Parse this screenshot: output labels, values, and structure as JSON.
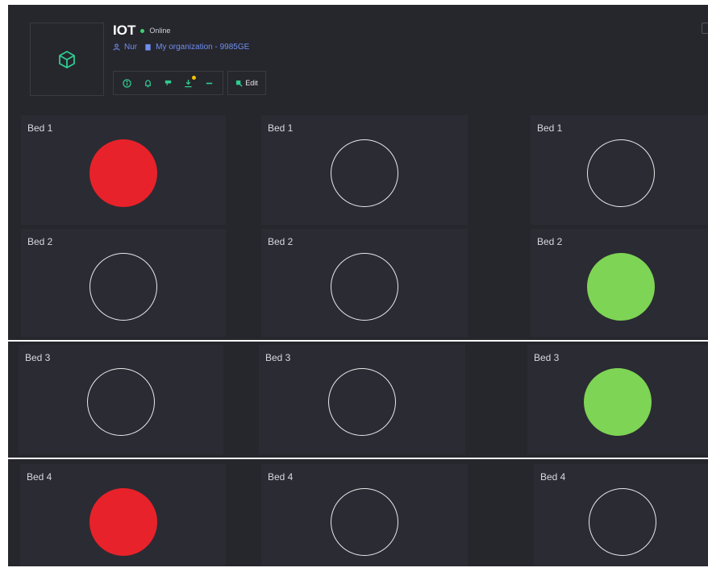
{
  "device": {
    "name": "IOT",
    "status": "Online",
    "user": "Nur",
    "organization": "My organization - 9985GE",
    "edit_label": "Edit",
    "colors": {
      "accent": "#2ecc8f",
      "status": "#3fd16f",
      "link": "#6f8ff0"
    }
  },
  "toolbar": {
    "icons": [
      "info-icon",
      "bell-icon",
      "map-pin-icon",
      "download-icon",
      "minus-icon"
    ]
  },
  "grid": {
    "rows": [
      {
        "cells": [
          {
            "label": "Bed 1",
            "state": "red"
          },
          {
            "label": "Bed 1",
            "state": "empty"
          },
          {
            "label": "Bed 1",
            "state": "empty"
          }
        ]
      },
      {
        "cells": [
          {
            "label": "Bed 2",
            "state": "empty"
          },
          {
            "label": "Bed 2",
            "state": "empty"
          },
          {
            "label": "Bed 2",
            "state": "green"
          }
        ]
      },
      {
        "cells": [
          {
            "label": "Bed 3",
            "state": "empty"
          },
          {
            "label": "Bed 3",
            "state": "empty"
          },
          {
            "label": "Bed 3",
            "state": "green"
          }
        ]
      },
      {
        "cells": [
          {
            "label": "Bed 4",
            "state": "red"
          },
          {
            "label": "Bed 4",
            "state": "empty"
          },
          {
            "label": "Bed 4",
            "state": "empty"
          }
        ]
      }
    ],
    "state_colors": {
      "red": "#e8222a",
      "green": "#7ed454",
      "empty": "transparent"
    }
  }
}
